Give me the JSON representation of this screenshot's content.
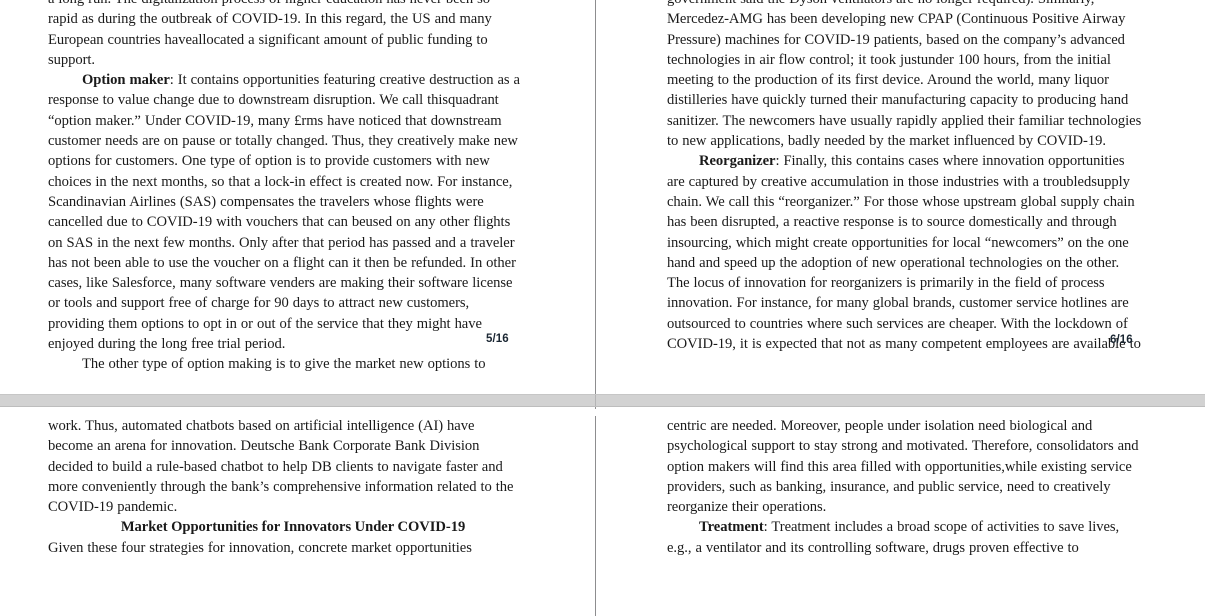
{
  "document": {
    "title": "Market Opportunities for Innovators Under COVID-19",
    "pages": [
      {
        "page_label": "5/16",
        "left_column": {
          "paragraphs": [
            {
              "id": "p1",
              "indent": false,
              "text": "a long run. The digitalization process of higher education has never been so rapid as during the outbreak of COVID-19. In this regard, the US and many European countries haveallocated a significant amount of public funding to support."
            },
            {
              "id": "p2",
              "indent": true,
              "run_in": "Option maker",
              "text": ": It contains opportunities featuring creative destruction as a response to value change due to downstream disruption. We call thisquadrant “option maker.” Under COVID-19, many £rms have noticed that downstream customer needs are on pause or totally changed. Thus, they creatively make new options for customers. One type of option is to provide customers with new choices in the next months, so that a lock-in effect is created now. For instance, Scandinavian Airlines (SAS) compensates the travelers whose flights were cancelled due to COVID-19 with vouchers that can beused on any other flights on SAS in the next few months. Only after that period has passed and a traveler has not been able to use the voucher on a flight can it then be refunded. In other cases, like Salesforce, many software venders are making their software license or tools and support free of charge for 90 days to attract new customers, providing them options to opt in or out of the service that they might have enjoyed during the long free trial period."
            },
            {
              "id": "p3",
              "indent": true,
              "text": "The other type of option making is to give the market new options to"
            }
          ]
        },
        "right_column": {
          "paragraphs": [
            {
              "id": "p4",
              "indent": false,
              "text": "government said the Dyson ventilators are no longer required). Similarly, Mercedez-AMG has been developing new CPAP (Continuous Positive Airway Pressure) machines for COVID-19 patients, based on the company’s advanced technologies in air flow control; it took justunder 100 hours, from the initial meeting to the production of its first device. Around the world, many liquor distilleries have quickly turned their manufacturing capacity to producing hand sanitizer. The newcomers have usually rapidly applied their familiar technologies to new applications, badly needed by the market influenced by COVID-19."
            },
            {
              "id": "p5",
              "indent": true,
              "run_in": "Reorganizer",
              "text": ": Finally, this contains cases where innovation opportunities are captured by creative accumulation in those industries with a troubledsupply chain. We call this “reorganizer.” For those whose upstream global supply chain has been disrupted, a reactive response is to source domestically and through insourcing, which might create opportunities for local “newcomers” on the one hand and speed up the adoption of new operational technologies on the other. The locus of innovation for reorganizers is primarily in the field of process innovation. For instance, for many global brands, customer service hotlines are outsourced to countries where such services are cheaper. With the lockdown of COVID-19, it is expected that not as many competent employees are available to"
            }
          ]
        }
      },
      {
        "page_label": "6/16",
        "left_column": {
          "paragraphs": [
            {
              "id": "p6",
              "indent": false,
              "text": "work. Thus, automated chatbots based on artificial intelligence (AI) have become an arena for innovation. Deutsche Bank Corporate Bank Division decided to build a rule-based chatbot to help DB clients to navigate faster and more conveniently through the bank’s comprehensive information related to the COVID-19 pandemic."
            }
          ],
          "heading": "Market Opportunities for Innovators Under COVID-19",
          "after_heading": {
            "id": "p7",
            "indent": false,
            "text": "Given these four strategies for innovation, concrete market opportunities"
          }
        },
        "right_column": {
          "paragraphs": [
            {
              "id": "p8",
              "indent": false,
              "text": "centric are needed. Moreover, people under isolation need biological and psychological support to stay strong and motivated. Therefore, consolidators and option makers will find this area filled with opportunities,while existing service providers, such as banking, insurance, and public service, need to creatively reorganize their operations."
            },
            {
              "id": "p9",
              "indent": true,
              "run_in": "Treatment",
              "text": ": Treatment includes a broad scope of activities to save lives, e.g., a ventilator and its controlling software, drugs proven effective to"
            }
          ]
        }
      }
    ]
  },
  "colors": {
    "page_background": "#ffffff",
    "text": "#1a1a1a",
    "separator_band": "#d2d2d2",
    "column_rule": "#8d8d8f",
    "page_number": "#1b2733"
  }
}
